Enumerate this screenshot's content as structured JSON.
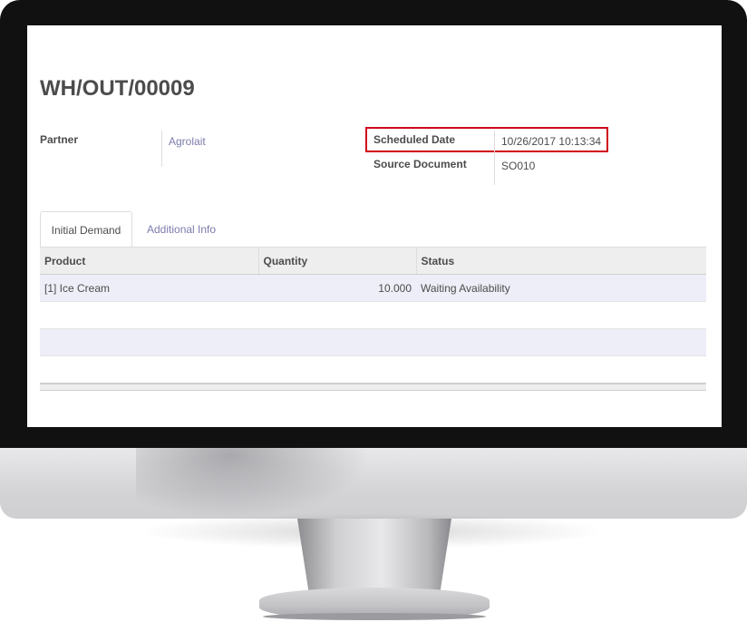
{
  "record": {
    "title": "WH/OUT/00009"
  },
  "fields": {
    "partner_label": "Partner",
    "partner_value": "Agrolait",
    "scheduled_date_label": "Scheduled Date",
    "scheduled_date_value": "10/26/2017 10:13:34",
    "source_document_label": "Source Document",
    "source_document_value": "SO010"
  },
  "tabs": [
    {
      "label": "Initial Demand",
      "active": true
    },
    {
      "label": "Additional Info",
      "active": false
    }
  ],
  "table": {
    "columns": [
      "Product",
      "Quantity",
      "Status"
    ],
    "rows": [
      {
        "product": "[1] Ice Cream",
        "quantity": "10.000",
        "status": "Waiting Availability"
      }
    ]
  },
  "colors": {
    "link": "#7c7bad",
    "highlight_border": "#d0021b",
    "text": "#4c4c4c",
    "row_alt": "#eeeef8"
  }
}
